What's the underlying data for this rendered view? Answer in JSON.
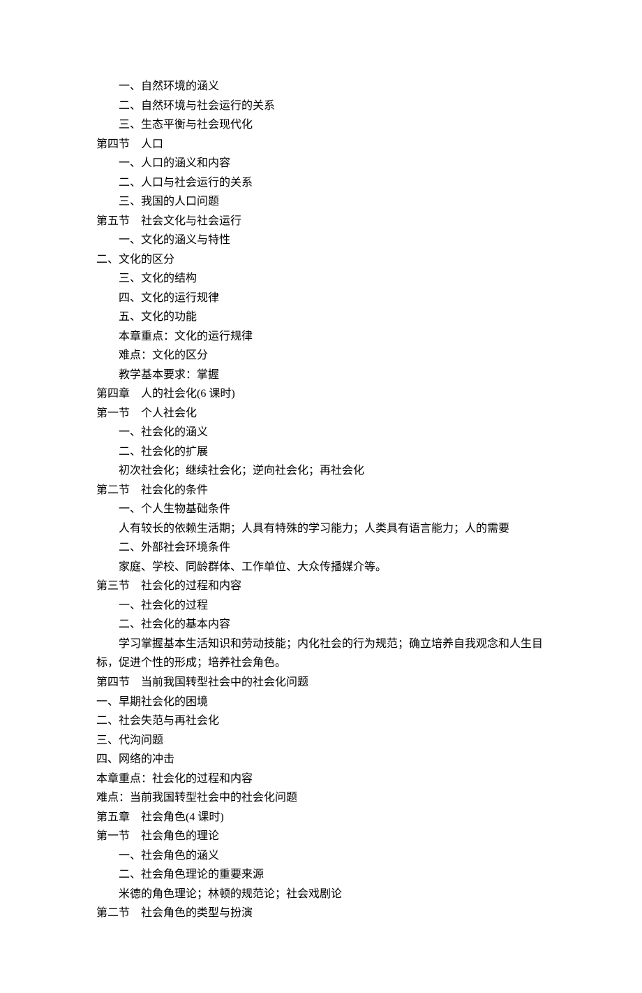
{
  "lines": [
    {
      "indent": 1,
      "text": "一、自然环境的涵义"
    },
    {
      "indent": 1,
      "text": "二、自然环境与社会运行的关系"
    },
    {
      "indent": 1,
      "text": "三、生态平衡与社会现代化"
    },
    {
      "indent": 0,
      "text": "第四节　人口"
    },
    {
      "indent": 1,
      "text": "一、人口的涵义和内容"
    },
    {
      "indent": 1,
      "text": "二、人口与社会运行的关系"
    },
    {
      "indent": 1,
      "text": "三、我国的人口问题"
    },
    {
      "indent": 0,
      "text": "第五节　社会文化与社会运行"
    },
    {
      "indent": 1,
      "text": "一、文化的涵义与特性"
    },
    {
      "indent": 0,
      "text": "二、文化的区分"
    },
    {
      "indent": 1,
      "text": "三、文化的结构"
    },
    {
      "indent": 1,
      "text": "四、文化的运行规律"
    },
    {
      "indent": 1,
      "text": "五、文化的功能"
    },
    {
      "indent": 1,
      "text": "本章重点：文化的运行规律"
    },
    {
      "indent": 1,
      "text": "难点：文化的区分"
    },
    {
      "indent": 1,
      "text": "教学基本要求：掌握"
    },
    {
      "indent": 0,
      "text": "第四章　人的社会化(6 课时)"
    },
    {
      "indent": 0,
      "text": "第一节　个人社会化"
    },
    {
      "indent": 1,
      "text": "一、社会化的涵义"
    },
    {
      "indent": 1,
      "text": "二、社会化的扩展"
    },
    {
      "indent": 1,
      "text": "初次社会化；继续社会化；逆向社会化；再社会化"
    },
    {
      "indent": 0,
      "text": "第二节　社会化的条件"
    },
    {
      "indent": 1,
      "text": "一、个人生物基础条件"
    },
    {
      "indent": 1,
      "text": "人有较长的依赖生活期；人具有特殊的学习能力；人类具有语言能力；人的需要"
    },
    {
      "indent": 1,
      "text": "二、外部社会环境条件"
    },
    {
      "indent": 1,
      "text": "家庭、学校、同龄群体、工作单位、大众传播媒介等。"
    },
    {
      "indent": 0,
      "text": "第三节　社会化的过程和内容"
    },
    {
      "indent": 1,
      "text": "一、社会化的过程"
    },
    {
      "indent": 1,
      "text": "二、社会化的基本内容"
    },
    {
      "indent": 1,
      "text": "学习掌握基本生活知识和劳动技能；内化社会的行为规范；确立培养自我观念和人生目"
    },
    {
      "indent": 0,
      "text": "标，促进个性的形成；培养社会角色。"
    },
    {
      "indent": 0,
      "text": "第四节　当前我国转型社会中的社会化问题"
    },
    {
      "indent": 0,
      "text": "一、早期社会化的困境"
    },
    {
      "indent": 0,
      "text": "二、社会失范与再社会化"
    },
    {
      "indent": 0,
      "text": "三、代沟问题"
    },
    {
      "indent": 0,
      "text": "四、网络的冲击"
    },
    {
      "indent": 0,
      "text": "本章重点：社会化的过程和内容"
    },
    {
      "indent": 0,
      "text": "难点：当前我国转型社会中的社会化问题"
    },
    {
      "indent": 0,
      "text": "第五章　社会角色(4 课时)"
    },
    {
      "indent": 0,
      "text": "第一节　社会角色的理论"
    },
    {
      "indent": 1,
      "text": "一、社会角色的涵义"
    },
    {
      "indent": 1,
      "text": "二、社会角色理论的重要来源"
    },
    {
      "indent": 1,
      "text": "米德的角色理论；林顿的规范论；社会戏剧论"
    },
    {
      "indent": 0,
      "text": "第二节　社会角色的类型与扮演"
    }
  ]
}
